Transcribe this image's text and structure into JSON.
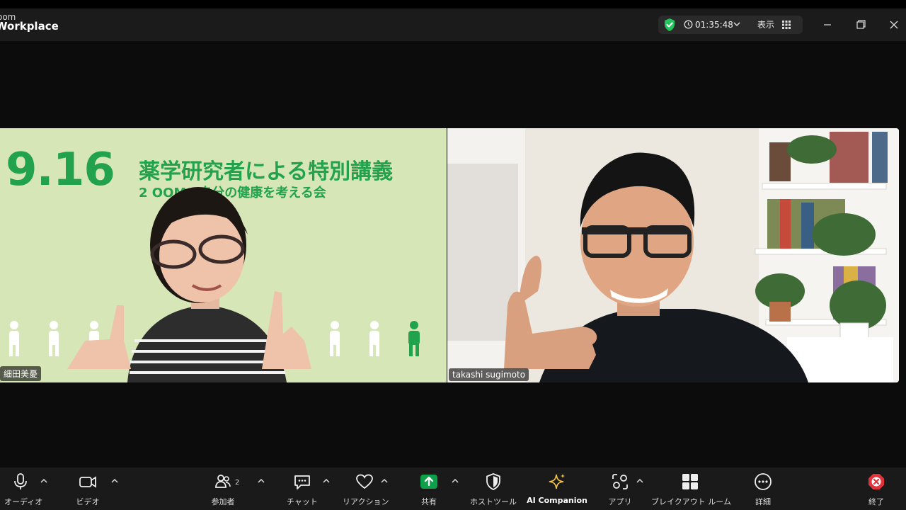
{
  "app": {
    "brand_line1": "oom",
    "brand_line2": "Workplace"
  },
  "status": {
    "timer": "01:35:48",
    "view_label": "表示"
  },
  "slide": {
    "date": "9.16",
    "title": "薬学研究者による特別講義",
    "subtitle": "2 OOM：自分の健康を考える会"
  },
  "participants": [
    {
      "name": "細田美憂"
    },
    {
      "name": "takashi sugimoto"
    }
  ],
  "toolbar": {
    "audio": "オーディオ",
    "video": "ビデオ",
    "participants": "参加者",
    "participants_count": "2",
    "chat": "チャット",
    "reactions": "リアクション",
    "share": "共有",
    "host_tools": "ホストツール",
    "ai_companion": "AI Companion",
    "apps": "アプリ",
    "breakout": "ブレイクアウト ルーム",
    "more": "詳細",
    "end": "終了"
  },
  "colors": {
    "share_green": "#0e9f4a",
    "slide_green": "#23a24d",
    "end_red": "#e0333c",
    "shield_green": "#22c55e"
  }
}
